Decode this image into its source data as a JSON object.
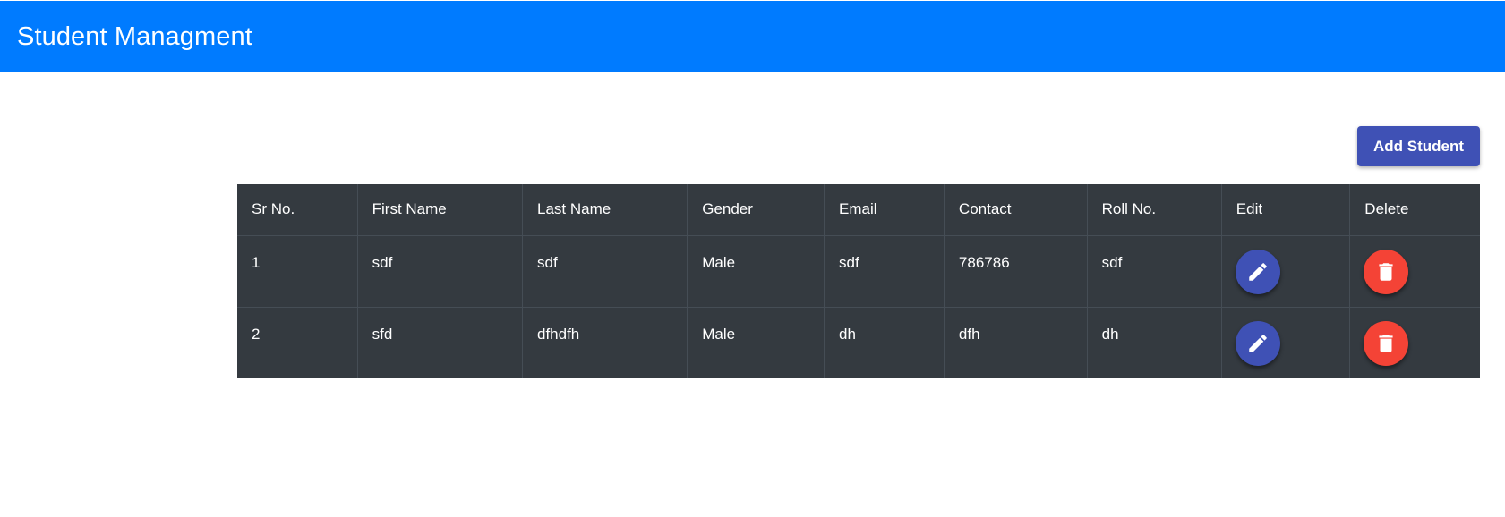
{
  "navbar": {
    "brand": "Student Managment",
    "color": "#007bff"
  },
  "toolbar": {
    "add_label": "Add Student",
    "color": "#3f51b5"
  },
  "table": {
    "headers": [
      "Sr No.",
      "First Name",
      "Last Name",
      "Gender",
      "Email",
      "Contact",
      "Roll No.",
      "Edit",
      "Delete"
    ],
    "rows": [
      {
        "sr": "1",
        "first": "sdf",
        "last": "sdf",
        "gender": "Male",
        "email": "sdf",
        "contact": "786786",
        "roll": "sdf",
        "edit_icon": "pencil-icon",
        "delete_icon": "trash-icon"
      },
      {
        "sr": "2",
        "first": "sfd",
        "last": "dfhdfh",
        "gender": "Male",
        "email": "dh",
        "contact": "dfh",
        "roll": "dh",
        "edit_icon": "pencil-icon",
        "delete_icon": "trash-icon"
      }
    ],
    "background": "#343a40",
    "edit_color": "#3f51b5",
    "delete_color": "#f44336"
  }
}
